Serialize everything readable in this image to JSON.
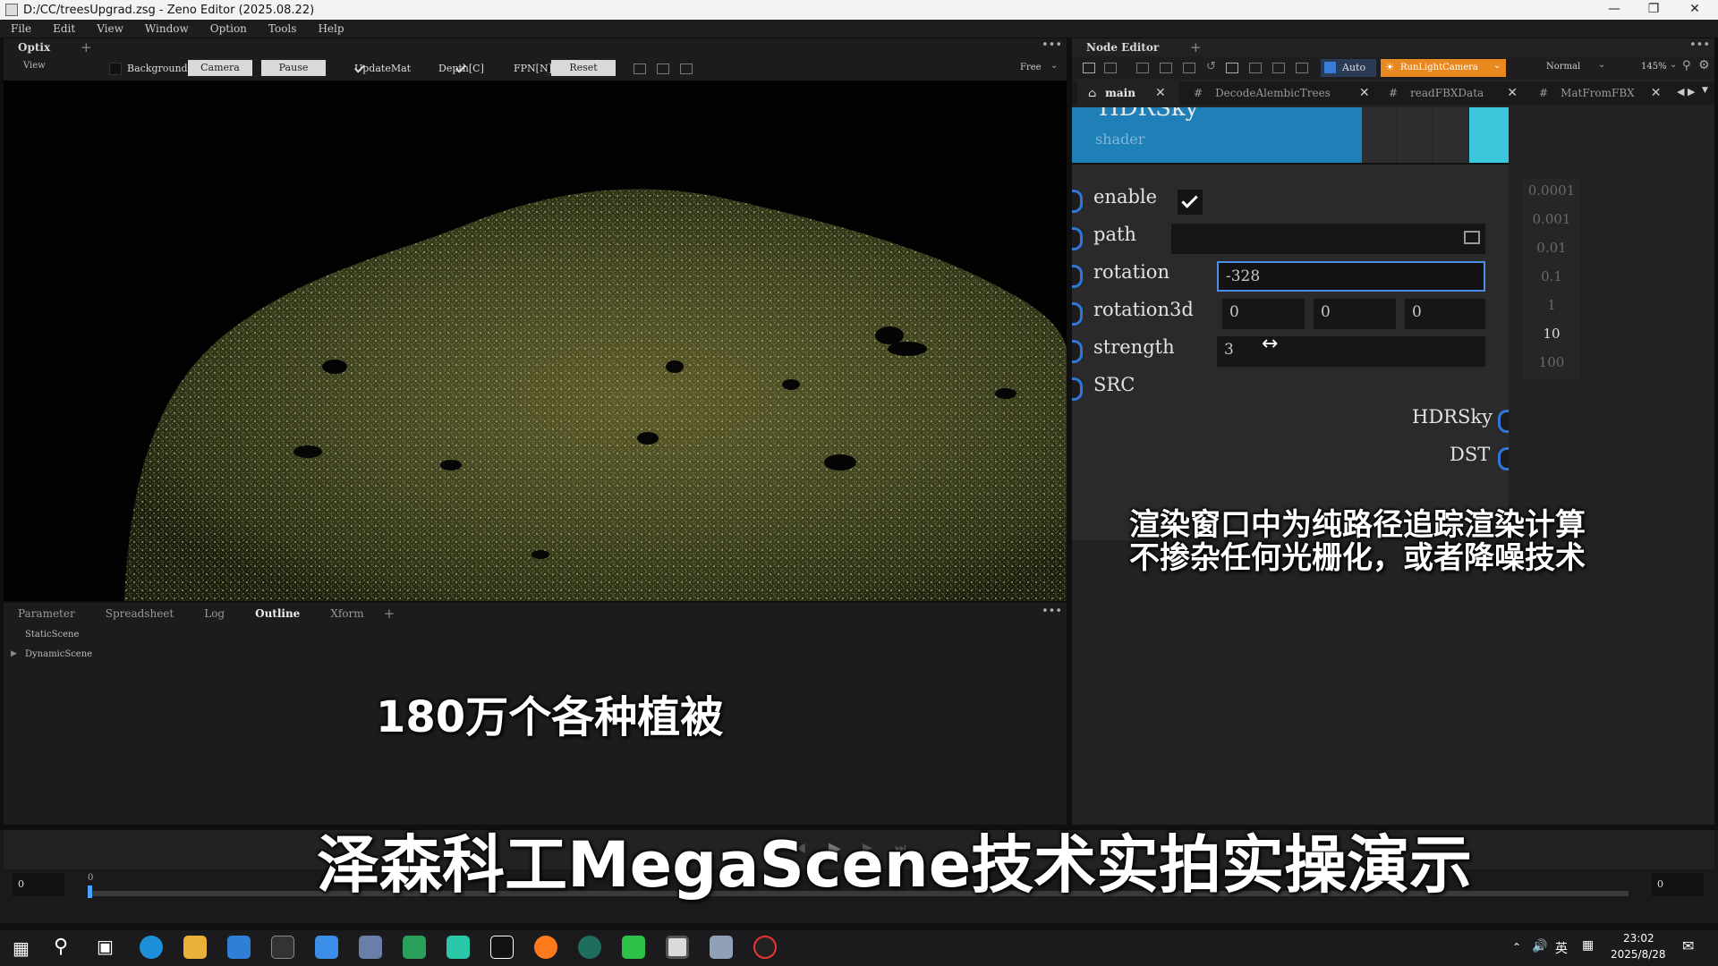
{
  "window": {
    "title": "D:/CC/treesUpgrad.zsg - Zeno Editor (2025.08.22)"
  },
  "menu": [
    "File",
    "Edit",
    "View",
    "Window",
    "Option",
    "Tools",
    "Help"
  ],
  "optix": {
    "tab": "Optix",
    "add": "+",
    "view_label": "View",
    "background": "Background",
    "camera": "Camera",
    "pause": "Pause",
    "updatemat": "UpdateMat",
    "depth": "Depth[C]",
    "fpn": "FPN[N]",
    "reset": "Reset",
    "mode": "Free"
  },
  "bottom_panel": {
    "tabs": [
      "Parameter",
      "Spreadsheet",
      "Log",
      "Outline",
      "Xform"
    ],
    "active_tab": "Outline",
    "add": "+",
    "tree": [
      "StaticScene",
      "DynamicScene"
    ]
  },
  "node_editor": {
    "title": "Node Editor",
    "add": "+",
    "auto": "Auto",
    "run_button": "RunLightCamera",
    "mode": "Normal",
    "zoom": "145%",
    "tabs": [
      {
        "name": "main"
      },
      {
        "name": "DecodeAlembicTrees"
      },
      {
        "name": "readFBXData"
      },
      {
        "name": "MatFromFBX"
      }
    ],
    "node": {
      "title_partial": "HDRSky",
      "category": "shader",
      "params": {
        "enable": "enable",
        "path": "path",
        "rotation": "rotation",
        "rotation_value": "-328",
        "rotation3d": "rotation3d",
        "rotation3d_values": [
          "0",
          "0",
          "0"
        ],
        "strength": "strength",
        "strength_value": "3",
        "src": "SRC"
      },
      "outputs": [
        "HDRSky",
        "DST"
      ]
    },
    "scale": [
      "0.0001",
      "0.001",
      "0.01",
      "0.1",
      "1",
      "10",
      "100"
    ]
  },
  "captions": {
    "right": [
      "渲染窗口中为纯路径追踪渲染计算",
      "不掺杂任何光栅化，或者降噪技术"
    ],
    "center": "180万个各种植被",
    "main": "泽森科工MegaScene技术实拍实操演示"
  },
  "timeline": {
    "start": "0",
    "end": "0",
    "marker": "0"
  },
  "taskbar": {
    "lang": "英",
    "time": "23:02",
    "date": "2025/8/28"
  },
  "colors": {
    "node_header": "#1f7fb7",
    "node_accent": "#3cc8dc",
    "run_button": "#e8881e",
    "socket": "#2d78d8"
  }
}
